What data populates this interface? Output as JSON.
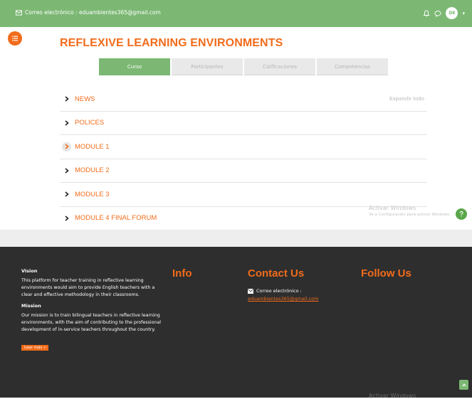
{
  "topbar": {
    "email_line": "Correo electrónico : eduambientes365@gmail.com",
    "avatar_initials": "DE",
    "color": "#7cb874"
  },
  "course": {
    "title": "REFLEXIVE LEARNING ENVIRONMENTS",
    "accent_color": "#f26c1b"
  },
  "tabs": [
    {
      "label": "Curso",
      "active": true
    },
    {
      "label": "Participantes",
      "active": false
    },
    {
      "label": "Calificaciones",
      "active": false
    },
    {
      "label": "Competencias",
      "active": false
    }
  ],
  "expand_all": "Expandir todo",
  "sections": [
    {
      "label": "NEWS"
    },
    {
      "label": "POLICES"
    },
    {
      "label": "MODULE 1"
    },
    {
      "label": "MODULE 2"
    },
    {
      "label": "MODULE 3"
    },
    {
      "label": "MODULE 4 FINAL FORUM"
    }
  ],
  "watermark": {
    "title": "Activar Windows",
    "subtitle": "Ve a Configuración para activar Windows."
  },
  "footer": {
    "vision_title": "Vision",
    "vision_text": "This platform for teacher training in reflective learning environments would aim to provide English teachers with a clear and effective methodology in their classrooms.",
    "mission_title": "Mission",
    "mission_text": "Our mission is to train bilingual teachers in reflective learning environments, with the aim of contributing to the professional development of in-service teachers throughout the country.",
    "read_more": "Leer más »",
    "info_heading": "Info",
    "contact_heading": "Contact Us",
    "contact_label": "Correo electrónico :",
    "contact_email": "eduambientes365@gmail.com",
    "follow_heading": "Follow Us"
  },
  "icons": {
    "mail": "envelope-icon",
    "bell": "bell-icon",
    "chat": "chat-bubble-icon",
    "drawer": "list-icon",
    "chevron": "chevron-right-icon",
    "help": "question-icon",
    "scroll": "chevron-up-icon"
  }
}
